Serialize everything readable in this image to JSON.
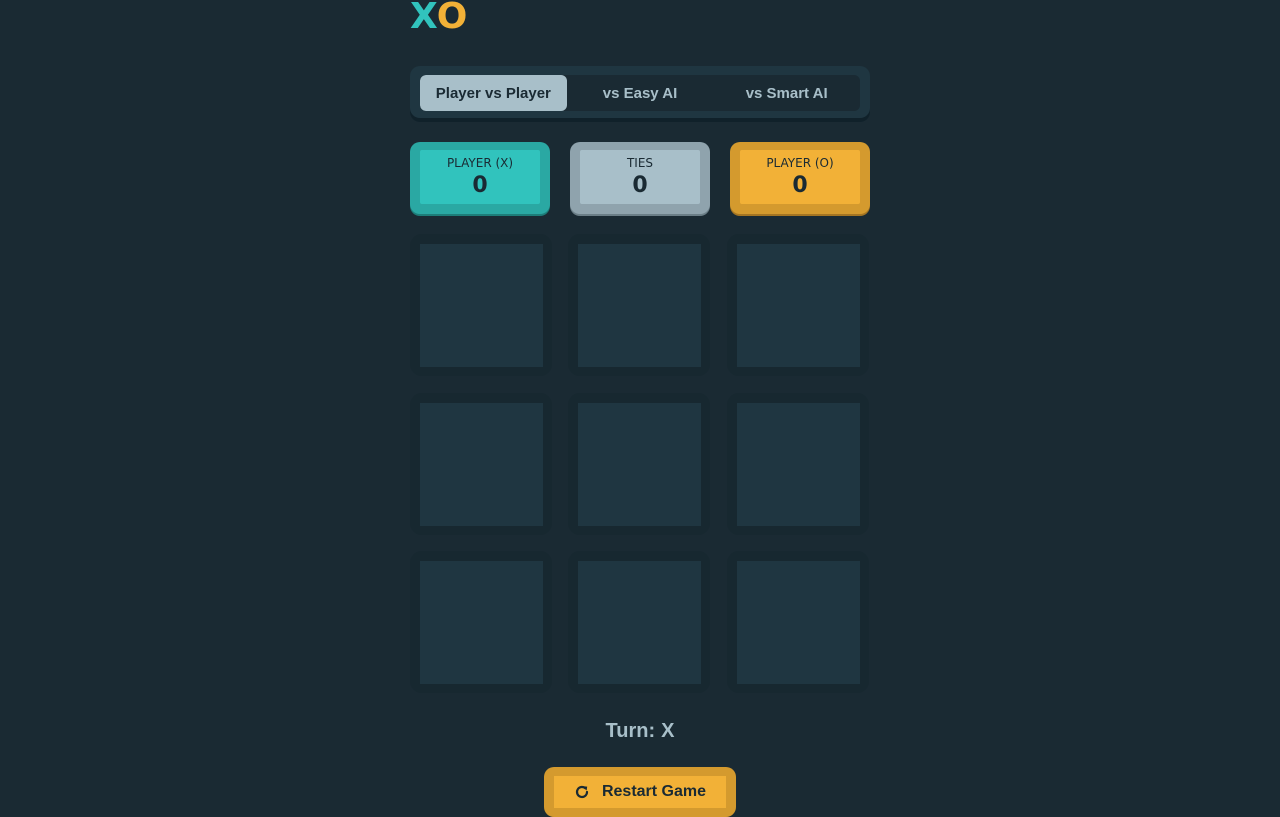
{
  "logo": {
    "x": "X",
    "o": "O"
  },
  "modes": [
    {
      "label": "Player vs Player",
      "active": true
    },
    {
      "label": "vs Easy AI",
      "active": false
    },
    {
      "label": "vs Smart AI",
      "active": false
    }
  ],
  "scores": {
    "x": {
      "label": "PLAYER (X)",
      "value": "0"
    },
    "ties": {
      "label": "TIES",
      "value": "0"
    },
    "o": {
      "label": "PLAYER (O)",
      "value": "0"
    }
  },
  "board": {
    "cells": [
      "",
      "",
      "",
      "",
      "",
      "",
      "",
      "",
      ""
    ]
  },
  "turn": {
    "label": "Turn:",
    "player": "X"
  },
  "restart": {
    "label": "Restart Game",
    "icon": "restart-icon"
  },
  "colors": {
    "background": "#1a2a33",
    "x_color": "#31c3bd",
    "o_color": "#f2b137",
    "silver": "#a8bfc9",
    "cell": "#1f3641"
  }
}
